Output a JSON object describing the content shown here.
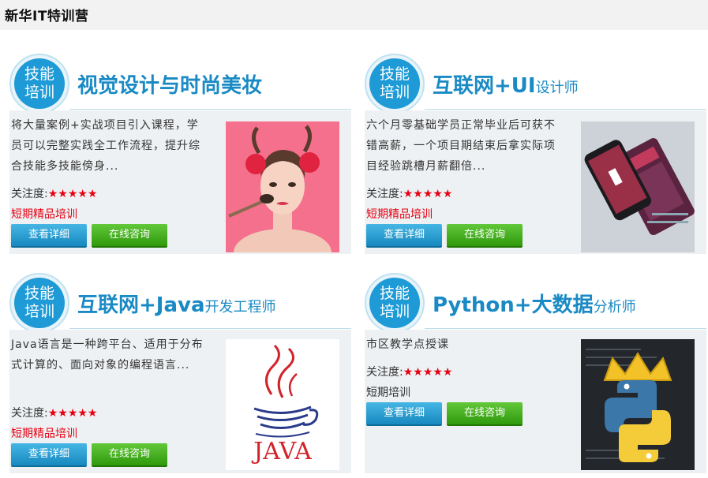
{
  "header": {
    "title": "新华IT特训营"
  },
  "badge": {
    "line1": "技能",
    "line2": "培训"
  },
  "cards": [
    {
      "heading_main": "视觉设计与时尚美妆",
      "heading_sub": "",
      "description": "将大量案例+实战项目引入课程，学员可以完整实践全工作流程，提升综合技能多技能傍身...",
      "rating_label": "关注度:",
      "stars": "★★★★★",
      "tag": "短期精品培训",
      "tag_color": "#e60012",
      "detail_button": "查看详细",
      "consult_button": "在线咨询",
      "image": "makeup-model-photo"
    },
    {
      "heading_main": "互联网+UI",
      "heading_sub": "设计师",
      "description": "六个月零基础学员正常毕业后可获不错高薪，一个项目期结束后拿实际项目经验跳槽月薪翻倍...",
      "rating_label": "关注度:",
      "stars": "★★★★★",
      "tag": "短期精品培训",
      "tag_color": "#e60012",
      "detail_button": "查看详细",
      "consult_button": "在线咨询",
      "image": "ui-design-phone-mockup"
    },
    {
      "heading_main": "互联网+Java",
      "heading_sub": "开发工程师",
      "description": "Java语言是一种跨平台、适用于分布式计算的、面向对象的编程语言...",
      "rating_label": "关注度:",
      "stars": "★★★★★",
      "tag": "短期精品培训",
      "tag_color": "#e60012",
      "detail_button": "查看详细",
      "consult_button": "在线咨询",
      "image": "java-logo"
    },
    {
      "heading_main": "Python+大数据",
      "heading_sub": "分析师",
      "description": "市区教学点授课",
      "rating_label": "关注度:",
      "stars": "★★★★★",
      "tag": "短期培训",
      "tag_color": "#333333",
      "detail_button": "查看详细",
      "consult_button": "在线咨询",
      "image": "python-logo-crown"
    }
  ]
}
